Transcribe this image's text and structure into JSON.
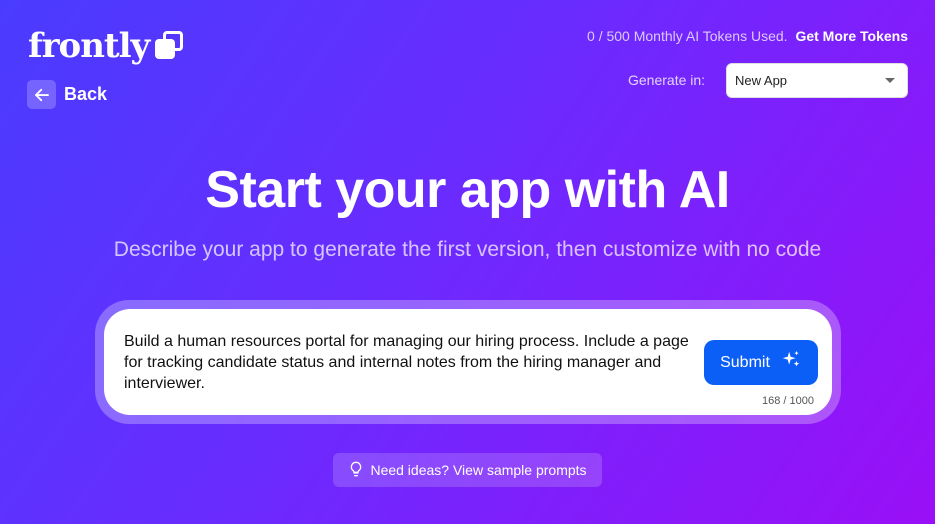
{
  "brand": {
    "name": "frontly",
    "logo_icon": "stacked-squares-icon"
  },
  "nav": {
    "back_label": "Back",
    "back_icon": "arrow-left-icon"
  },
  "tokens": {
    "usage_text": "0 / 500 Monthly AI Tokens Used.",
    "link_label": "Get More Tokens"
  },
  "generate": {
    "label": "Generate in:",
    "selected": "New App"
  },
  "hero": {
    "title": "Start your app with AI",
    "subtitle": "Describe your app to generate the first version, then customize with no code"
  },
  "prompt": {
    "value": "Build a human resources portal for managing our hiring process. Include a page for tracking candidate status and internal notes from the hiring manager and interviewer.",
    "submit_label": "Submit",
    "submit_icon": "sparkles-icon",
    "counter": "168 / 1000"
  },
  "ideas": {
    "label": "Need ideas? View sample prompts",
    "icon": "lightbulb-icon"
  },
  "colors": {
    "submit": "#0b5ff7",
    "gradient_start": "#4a3cff",
    "gradient_end": "#9a0ff6"
  }
}
